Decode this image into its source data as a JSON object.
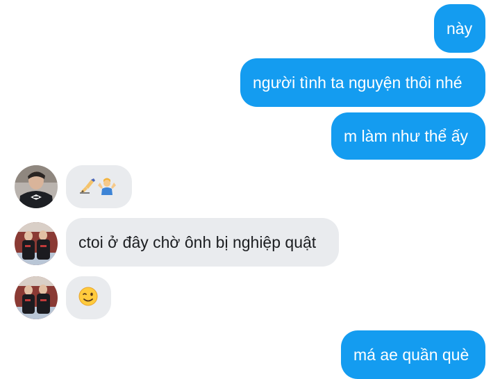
{
  "messages": {
    "m1": {
      "text": "này"
    },
    "m2": {
      "text": "người tình ta nguyện thôi nhé"
    },
    "m3": {
      "text": "m làm như thể ấy"
    },
    "m4": {
      "emojis": [
        "writing-hand-icon",
        "person-shrugging-icon"
      ]
    },
    "m5": {
      "text": "ctoi ở đây chờ ônh bị nghiệp quật"
    },
    "m6": {
      "emojis": [
        "winking-face-icon"
      ]
    },
    "m7": {
      "text": "má ae quần què"
    }
  },
  "colors": {
    "outgoing_bubble": "#149cf0",
    "outgoing_text": "#ffffff",
    "incoming_bubble": "#e9ebee",
    "incoming_text": "#1c1e21"
  }
}
